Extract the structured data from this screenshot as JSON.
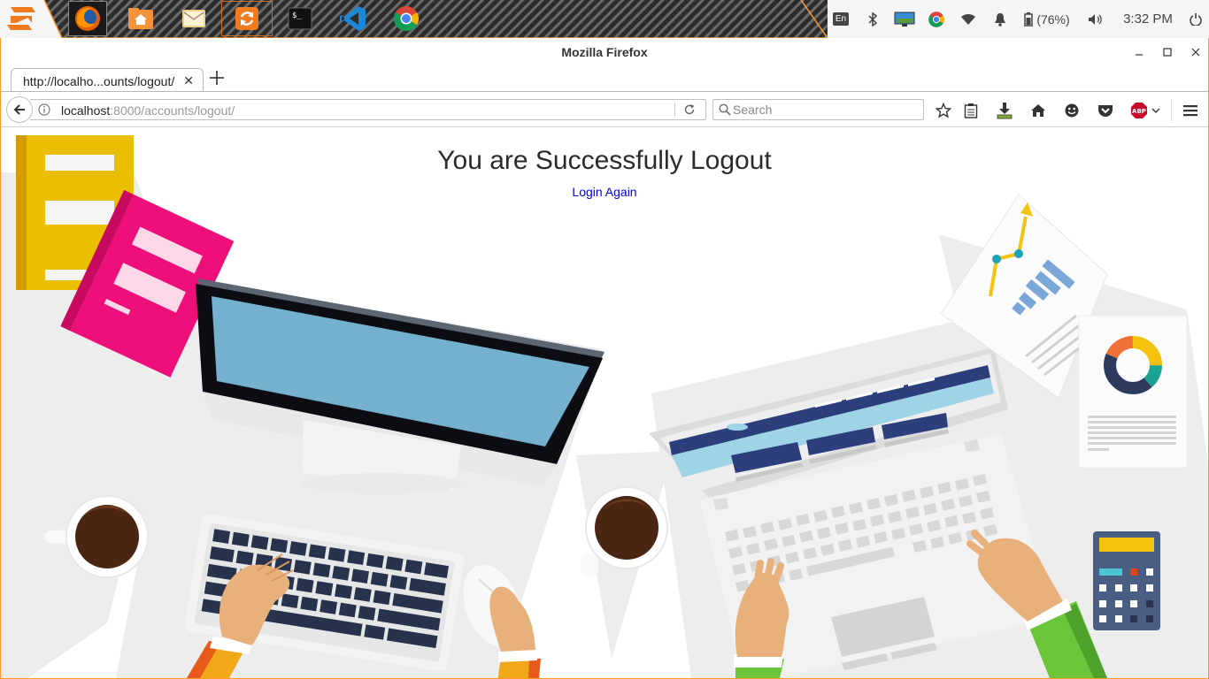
{
  "taskbar": {
    "apps": [
      {
        "name": "zorin-menu-icon"
      },
      {
        "name": "firefox-icon"
      },
      {
        "name": "files-icon"
      },
      {
        "name": "mail-icon"
      },
      {
        "name": "software-updater-icon"
      },
      {
        "name": "terminal-icon"
      },
      {
        "name": "vscode-icon"
      },
      {
        "name": "chrome-icon"
      }
    ],
    "tray": {
      "keyboard_layout": "En",
      "battery": "(76%)",
      "time": "3:32 PM"
    }
  },
  "window": {
    "title": "Mozilla Firefox"
  },
  "browser": {
    "tab_title": "http://localho...ounts/logout/",
    "url_host": "localhost",
    "url_rest": ":8000/accounts/logout/",
    "search_placeholder": "Search"
  },
  "page": {
    "heading": "You are Successfully Logout",
    "link_label": "Login Again"
  }
}
